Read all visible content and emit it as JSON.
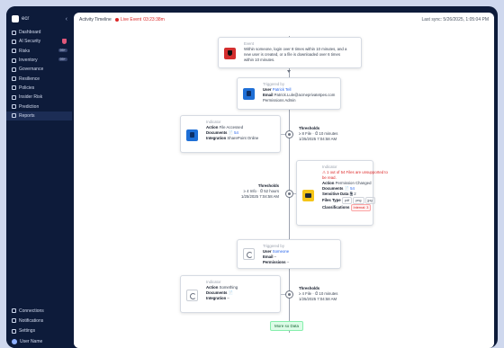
{
  "sidebar": {
    "brand": "ecr",
    "collapse_glyph": "‹",
    "items": [
      {
        "label": "Dashboard",
        "icon": "grid-icon"
      },
      {
        "label": "AI Security",
        "icon": "shield-ai-icon",
        "badge_icon": "shield"
      },
      {
        "label": "Risks",
        "icon": "risk-icon",
        "badge": "99+"
      },
      {
        "label": "Inventory",
        "icon": "inventory-icon",
        "badge": "99+"
      },
      {
        "label": "Governance",
        "icon": "governance-icon"
      },
      {
        "label": "Resilience",
        "icon": "chart-icon"
      },
      {
        "label": "Policies",
        "icon": "policy-icon"
      },
      {
        "label": "Insider Risk",
        "icon": "user-icon"
      },
      {
        "label": "Prediction",
        "icon": "prediction-icon"
      },
      {
        "label": "Reports",
        "icon": "report-icon"
      }
    ],
    "bottom": [
      {
        "label": "Connections",
        "icon": "plug-icon"
      },
      {
        "label": "Notifications",
        "icon": "bell-icon"
      },
      {
        "label": "Settings",
        "icon": "gear-icon"
      },
      {
        "label": "User Name",
        "icon": "avatar"
      }
    ]
  },
  "header": {
    "title": "Activity Timeline",
    "live_label": "Live Event",
    "live_time": "03:23:38m",
    "last_sync": "Last sync: 5/26/2025, 1:05:04 PM"
  },
  "timeline": {
    "event": {
      "eyebrow": "Event",
      "lines": [
        "Within someone, login over 8 times within 10 minutes, and a",
        "new user is created, or a file is downloaded over 6 times",
        "within 10 minutes."
      ]
    },
    "trigger1": {
      "eyebrow": "Triggered by",
      "user_label": "User",
      "user_value": "Patrick Tell",
      "email_label": "Email",
      "email_value": "Patrick.Lule@acmeprivatetpes.com",
      "perm_label": "Permissions",
      "perm_value": "Admin"
    },
    "indicator1": {
      "eyebrow": "Indicator",
      "action_label": "Action",
      "action_value": "File Accessed",
      "docs_label": "Documents",
      "docs_value": "54",
      "integ_label": "Integration",
      "integ_value": "SharePoint Online"
    },
    "threshold1": {
      "title": "Thresholds",
      "line1": "≥ 8 File · ⏱ 10 minutes",
      "line2": "1/25/2025 7:04:58 AM"
    },
    "threshold2": {
      "title": "Thresholds",
      "line1": "≥ 4 Info · ⏱ 52 hours",
      "line2": "1/25/2025 7:04:58 AM"
    },
    "indicator2": {
      "eyebrow": "Indicator",
      "warning": "⚠ 1 out of 54 Files are unsupported to",
      "warning2": "be read.",
      "action_label": "Action",
      "action_value": "Permission Changed",
      "docs_label": "Documents",
      "docs_value": "54",
      "sens_label": "Sensitive Data",
      "sens_value": "2",
      "types_label": "Files Type",
      "types": [
        "pdf",
        "png",
        "jpg"
      ],
      "class_label": "Classifications",
      "class_value": "Internal: 3"
    },
    "trigger2": {
      "eyebrow": "Triggered by",
      "user_label": "User",
      "user_value": "Someone",
      "email_label": "Email",
      "email_value": "–",
      "perm_label": "Permissions",
      "perm_value": "–"
    },
    "indicator3": {
      "eyebrow": "Indicator",
      "action_label": "Action",
      "action_value": "Something",
      "docs_label": "Documents",
      "docs_value": "",
      "integ_label": "Integration",
      "integ_value": "–"
    },
    "threshold3": {
      "title": "Thresholds",
      "line1": "≥ 4 File · ⏱ 10 minutes",
      "line2": "1/25/2025 7:04:58 AM"
    },
    "more_label": "More so Data"
  }
}
